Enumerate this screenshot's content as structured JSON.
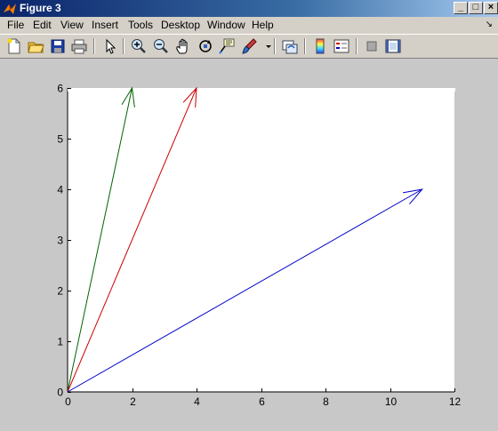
{
  "window": {
    "title": "Figure 3",
    "minimize": "_",
    "maximize": "□",
    "close": "×"
  },
  "menu": {
    "items": [
      "File",
      "Edit",
      "View",
      "Insert",
      "Tools",
      "Desktop",
      "Window",
      "Help"
    ],
    "dock_icon": "↘"
  },
  "toolbar": {
    "buttons": [
      "new-figure-icon",
      "open-file-icon",
      "save-icon",
      "print-icon",
      "edit-plot-arrow-icon",
      "zoom-in-icon",
      "zoom-out-icon",
      "pan-hand-icon",
      "rotate-3d-icon",
      "data-cursor-icon",
      "brush-icon",
      "link-plot-icon",
      "colorbar-icon",
      "legend-icon",
      "hide-plot-tools-icon",
      "show-plot-tools-icon"
    ]
  },
  "chart_data": {
    "type": "quiver",
    "xlim": [
      0,
      12
    ],
    "ylim": [
      0,
      6
    ],
    "xticks": [
      "0",
      "2",
      "4",
      "6",
      "8",
      "10",
      "12"
    ],
    "yticks": [
      "0",
      "1",
      "2",
      "3",
      "4",
      "5",
      "6"
    ],
    "grid": false,
    "vectors": [
      {
        "origin": [
          0,
          0
        ],
        "tip": [
          2,
          6
        ],
        "color": "#006400"
      },
      {
        "origin": [
          0,
          0
        ],
        "tip": [
          4,
          6
        ],
        "color": "#cc0000"
      },
      {
        "origin": [
          0,
          0
        ],
        "tip": [
          11,
          4
        ],
        "color": "#0000cc"
      }
    ],
    "background": "#ffffff",
    "figure_background": "#c8c8c8"
  }
}
